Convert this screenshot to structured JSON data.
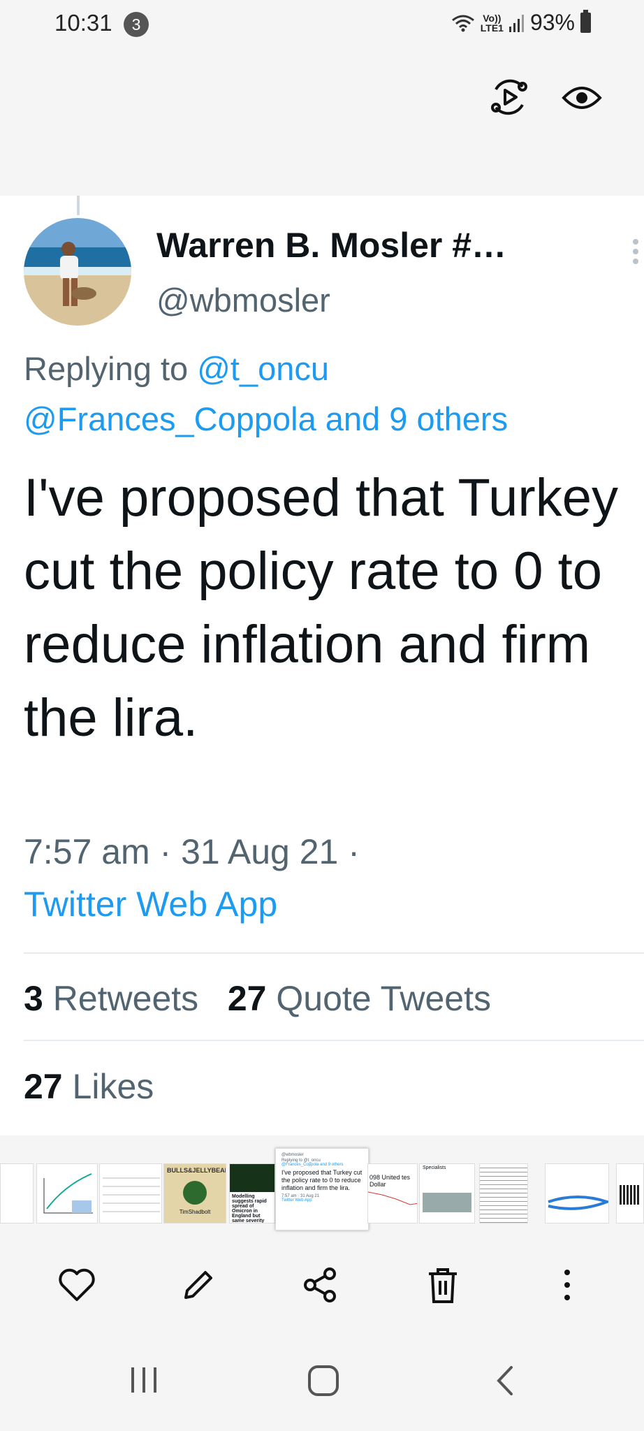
{
  "status_bar": {
    "time": "10:31",
    "notification_count": "3",
    "network_line1": "Vo))",
    "network_line2": "LTE1",
    "battery_percent": "93%"
  },
  "viewer": {
    "icons": [
      "motion-photo-icon",
      "eye-icon"
    ]
  },
  "tweet": {
    "author_name": "Warren B. Mosler #…",
    "author_handle": "@wbmosler",
    "replying_to_prefix": "Replying to ",
    "replying_to_first": "@t_oncu",
    "replying_to_second": "@Frances_Coppola and 9 others",
    "text": "I've proposed that Turkey cut the policy rate to 0 to reduce inflation and firm the lira.",
    "timestamp": "7:57 am · 31 Aug 21 ·",
    "source": "Twitter Web App",
    "retweets_count": "3",
    "retweets_label": "Retweets",
    "quotes_count": "27",
    "quotes_label": "Quote Tweets",
    "likes_count": "27",
    "likes_label": "Likes"
  },
  "filmstrip": {
    "current_thumb": {
      "handle": "@wbmosler",
      "reply": "Replying to @t_oncu",
      "reply2": "@Frances_Coppola and 9 others",
      "text": "I've proposed that Turkey cut the policy rate to 0 to reduce inflation and firm the lira.",
      "time": "7:57 am · 31 Aug 21",
      "source": "Twitter Web App"
    },
    "thumb_texts": {
      "bulls": "BULLS",
      "jelly": "JELLYBEANS",
      "tim": "TimShadbolt",
      "modelling": "Modelling suggests rapid spread of Omicron in England but same severity",
      "dollar": "098 United tes Dollar",
      "specialists": "Specialists"
    }
  },
  "actions": [
    "heart-icon",
    "pencil-icon",
    "share-icon",
    "trash-icon",
    "more-vertical-icon"
  ],
  "navbar": [
    "recents-icon",
    "home-icon",
    "back-icon"
  ],
  "colors": {
    "link": "#1d9bf0",
    "text": "#0f1419",
    "secondary": "#536471",
    "background": "#f5f5f5"
  }
}
